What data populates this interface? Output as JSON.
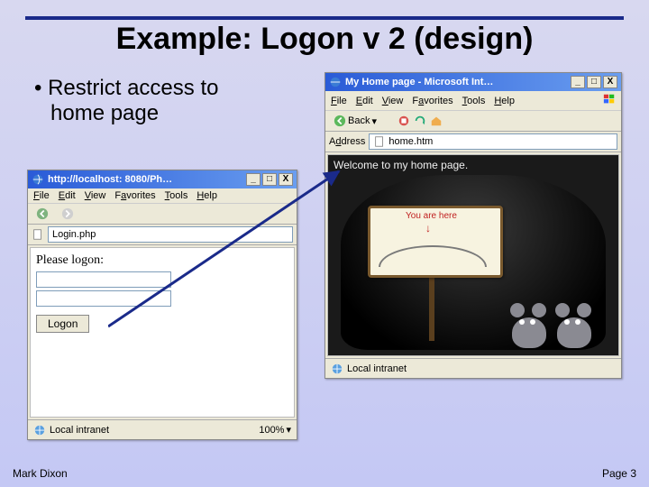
{
  "slide": {
    "title": "Example: Logon v 2 (design)",
    "bullet_line1": "Restrict access to",
    "bullet_line2": "home page",
    "footer_author": "Mark Dixon",
    "footer_page": "Page 3"
  },
  "left_browser": {
    "titlebar": "http://localhost: 8080/Ph…",
    "menu": {
      "file": "File",
      "edit": "Edit",
      "view": "View",
      "favorites": "Favorites",
      "tools": "Tools",
      "help": "Help"
    },
    "address_value": "Login.php",
    "content": {
      "prompt": "Please logon:",
      "logon_button": "Logon"
    },
    "status": "Local intranet",
    "zoom": "100%"
  },
  "right_browser": {
    "titlebar": "My Home page - Microsoft Int…",
    "menu": {
      "file": "File",
      "edit": "Edit",
      "view": "View",
      "favorites": "Favorites",
      "tools": "Tools",
      "help": "Help"
    },
    "toolbar": {
      "back": "Back"
    },
    "address_label": "Address",
    "address_value": "home.htm",
    "content": {
      "welcome": "Welcome to my home page.",
      "sign_label": "You are here"
    },
    "status": "Local intranet"
  },
  "win_buttons": {
    "min": "_",
    "max": "□",
    "close": "X"
  },
  "icons": {
    "ie": "ie-icon",
    "back": "back-icon",
    "dropdown": "chevron-down-icon",
    "stop": "stop-icon",
    "refresh": "refresh-icon",
    "home": "home-icon",
    "globe": "globe-icon",
    "page": "page-icon",
    "flag": "windows-flag-icon"
  }
}
